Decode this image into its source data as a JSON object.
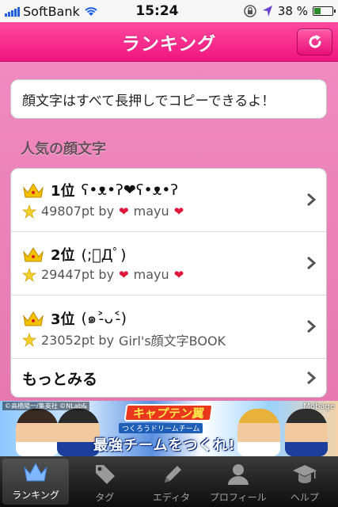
{
  "status_bar": {
    "carrier": "SoftBank",
    "time": "15:24",
    "battery_percent": "38 %",
    "battery_level": 0.38
  },
  "nav": {
    "title": "ランキング",
    "refresh_icon": "refresh-icon"
  },
  "notice": {
    "text": "顔文字はすべて長押しでコピーできるよ！"
  },
  "section": {
    "title": "人気の顔文字"
  },
  "rankings": [
    {
      "rank": "1位",
      "face": "ʕ•ᴥ•ʔ❤ʕ•ᴥ•ʔ",
      "points": "49807pt by",
      "author": "mayu",
      "author_hearts": true
    },
    {
      "rank": "2位",
      "face": "(;ﾟДﾟ)",
      "points": "29447pt by",
      "author": "mayu",
      "author_hearts": true
    },
    {
      "rank": "3位",
      "face": "(๑˃̵ᴗ˂̵)",
      "points": "23052pt by",
      "author": "Girl's顔文字BOOK",
      "author_hearts": false
    }
  ],
  "more": {
    "label": "もっとみる"
  },
  "banner": {
    "credit": "©高橋陽一/集英社 ©NLab&",
    "brand": "Mobage",
    "logo": "キャプテン翼",
    "subtitle": "つくろうドリームチーム",
    "cta": "最強チームをつくれ!"
  },
  "tabs": [
    {
      "label": "ランキング",
      "icon": "crown-icon",
      "active": true
    },
    {
      "label": "タグ",
      "icon": "tag-icon",
      "active": false
    },
    {
      "label": "エディタ",
      "icon": "pencil-icon",
      "active": false
    },
    {
      "label": "プロフィール",
      "icon": "person-icon",
      "active": false
    },
    {
      "label": "ヘルプ",
      "icon": "graduation-cap-icon",
      "active": false
    }
  ],
  "colors": {
    "accent": "#f0147e",
    "background": "#e67ab0",
    "heart": "#e0163a"
  }
}
